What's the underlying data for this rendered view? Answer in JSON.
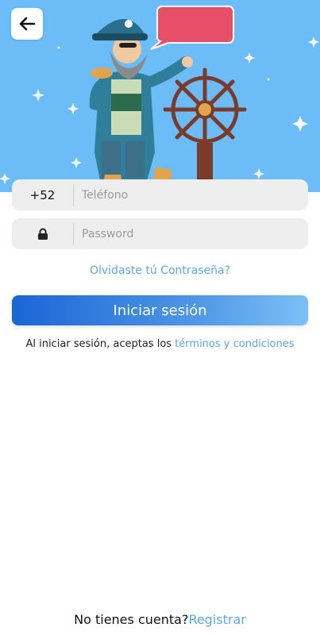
{
  "phone_field": {
    "prefix": "+52",
    "placeholder": "Teléfono"
  },
  "password_field": {
    "placeholder": "Password"
  },
  "forgot_link": "Olvidaste tú Contraseña?",
  "login_button": "Iniciar sesión",
  "terms": {
    "text": "Al iniciar sesión, aceptas los ",
    "link": "términos y condiciones"
  },
  "register": {
    "text": "No tienes cuenta?",
    "link": "Registrar"
  },
  "colors": {
    "hero_bg": "#6cbcf7",
    "accent": "#5aa9e6",
    "button_start": "#1a66d6",
    "button_end": "#7cc0f5",
    "speech_bubble": "#e8506a"
  },
  "icons": {
    "back": "arrow-left-icon",
    "lock": "lock-icon"
  }
}
